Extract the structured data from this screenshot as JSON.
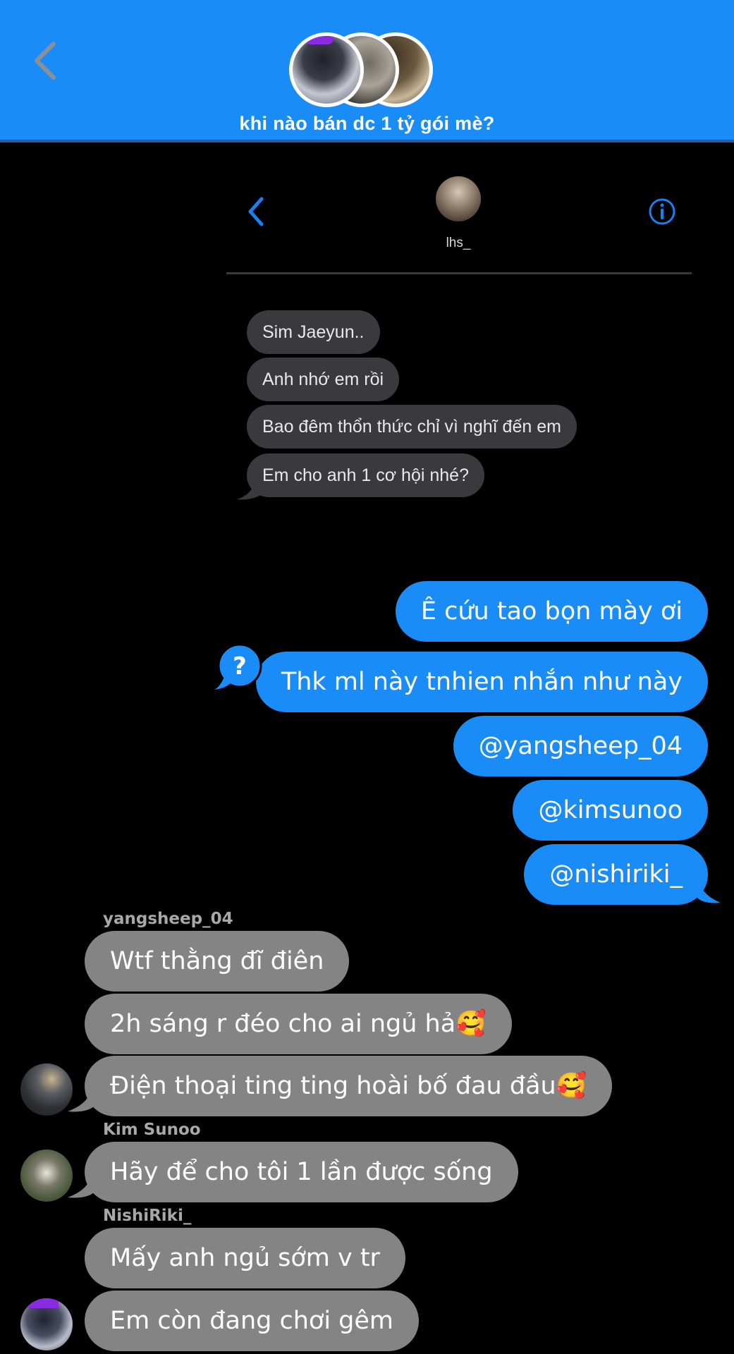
{
  "header": {
    "group_title": "khi nào bán dc 1 tỷ gói mè?",
    "accent_color": "#1a8cf7",
    "back_icon": "chevron-left-icon"
  },
  "embedded_screenshot": {
    "username": "lhs_",
    "messages": [
      "Sim Jaeyun..",
      "Anh nhớ em rồi",
      "Bao đêm thổn thức chỉ vì nghĩ đến em",
      "Em cho anh 1 cơ hội nhé?"
    ]
  },
  "my_messages": [
    "Ê cứu tao bọn mày ơi",
    "Thk ml này tnhien nhắn như này",
    "@yangsheep_04",
    "@kimsunoo",
    "@nishiriki_"
  ],
  "groups": [
    {
      "sender": "yangsheep_04",
      "messages": [
        "Wtf thằng đĩ điên",
        "2h sáng r đéo cho ai ngủ hả🥰",
        "Điện thoại ting ting hoài bố đau đầu🥰"
      ]
    },
    {
      "sender": "Kim Sunoo",
      "messages": [
        "Hãy để cho tôi 1 lần được sống"
      ]
    },
    {
      "sender": "NishiRiki_",
      "messages": [
        "Mấy anh ngủ sớm v tr",
        "Em còn đang chơi gêm"
      ]
    }
  ],
  "colors": {
    "my_bubble": "#1a8cf7",
    "their_bubble": "#848484",
    "background": "#000000"
  }
}
